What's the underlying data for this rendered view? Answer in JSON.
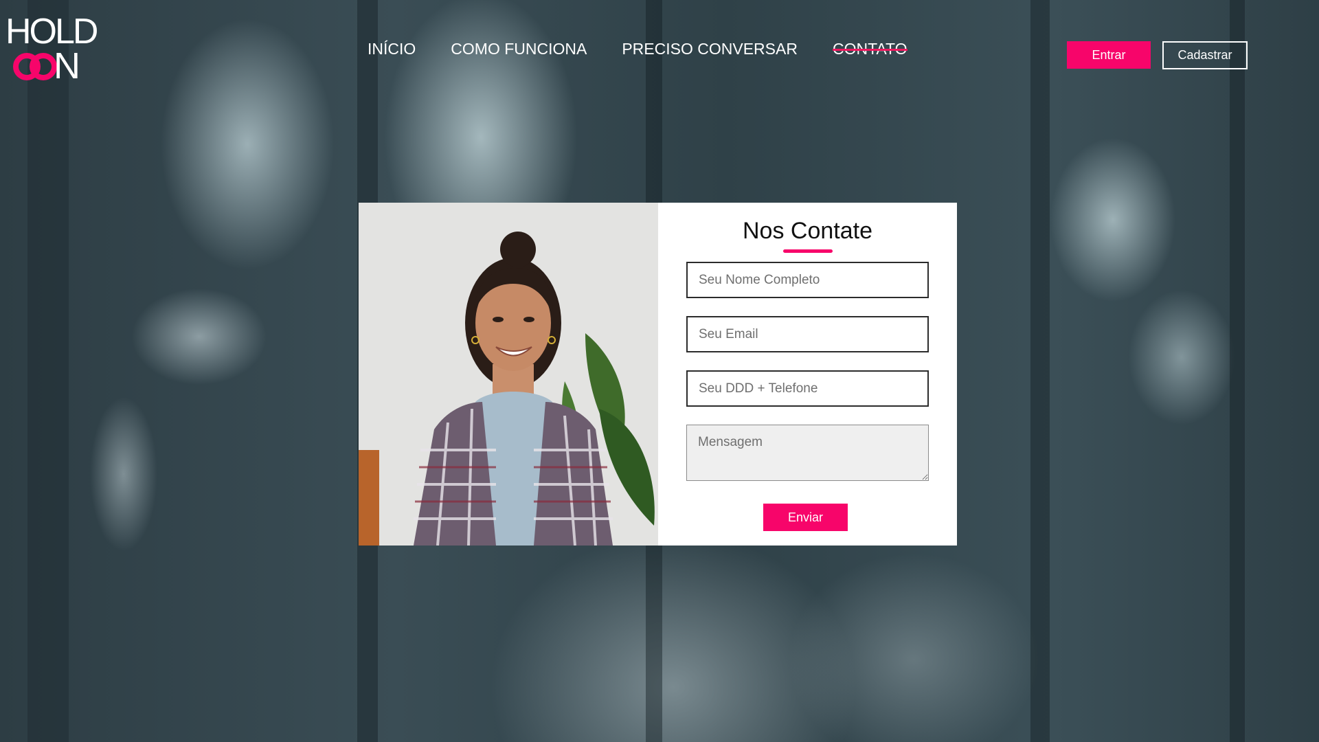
{
  "logo": {
    "text_top": "HOLD",
    "text_bottom": "N",
    "rings_color": "#f7056a"
  },
  "nav": {
    "items": [
      {
        "label": "INÍCIO",
        "active": false
      },
      {
        "label": "COMO FUNCIONA",
        "active": false
      },
      {
        "label": "PRECISO CONVERSAR",
        "active": false
      },
      {
        "label": "CONTATO",
        "active": true
      }
    ]
  },
  "auth": {
    "login_label": "Entrar",
    "signup_label": "Cadastrar"
  },
  "contact": {
    "title": "Nos Contate",
    "name_placeholder": "Seu Nome Completo",
    "email_placeholder": "Seu Email",
    "phone_placeholder": "Seu DDD + Telefone",
    "message_placeholder": "Mensagem",
    "submit_label": "Enviar"
  },
  "colors": {
    "accent": "#f7056a",
    "card_bg": "#ffffff",
    "background_tint": "#34474f"
  }
}
